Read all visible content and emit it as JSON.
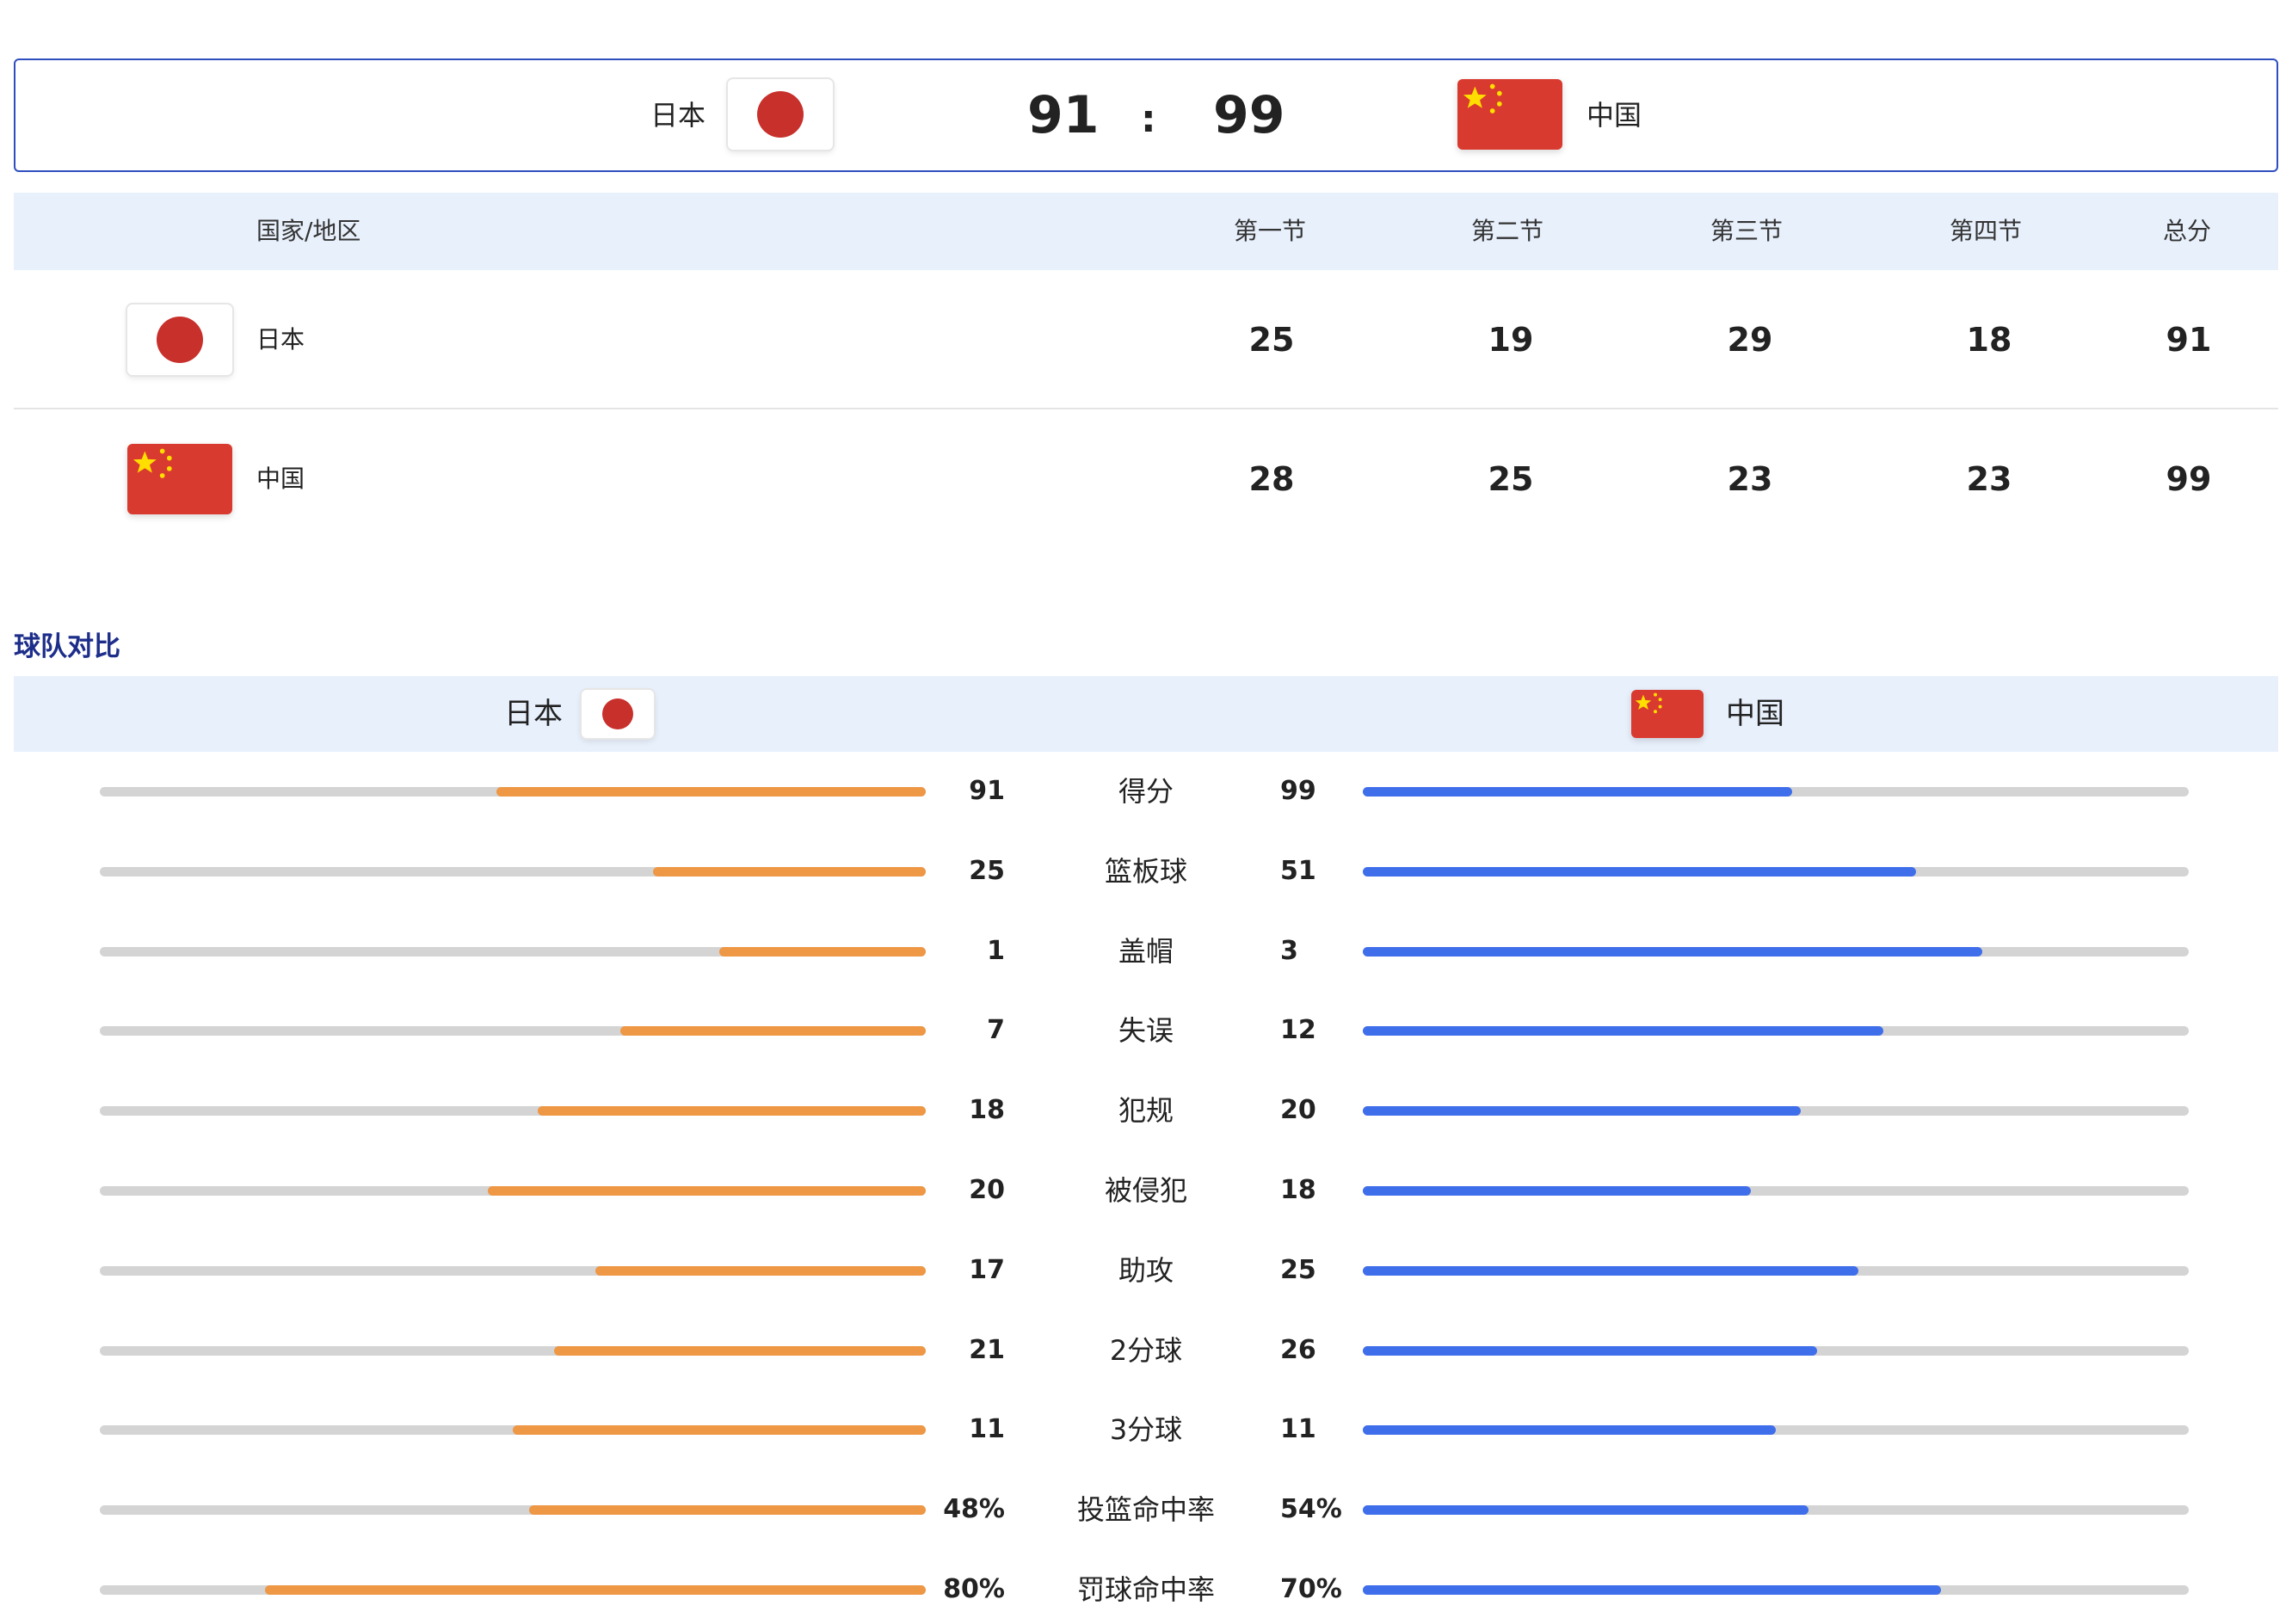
{
  "header": {
    "home_name": "日本",
    "home_score": "91",
    "separator": ":",
    "away_score": "99",
    "away_name": "中国"
  },
  "quarters": {
    "headers": [
      "国家/地区",
      "第一节",
      "第二节",
      "第三节",
      "第四节",
      "总分"
    ],
    "rows": [
      {
        "team": "日本",
        "flag": "japan-flag",
        "values": [
          "25",
          "19",
          "29",
          "18",
          "91"
        ]
      },
      {
        "team": "中国",
        "flag": "china-flag",
        "values": [
          "28",
          "25",
          "23",
          "23",
          "99"
        ]
      }
    ]
  },
  "compare": {
    "title": "球队对比",
    "home_name": "日本",
    "away_name": "中国",
    "colors": {
      "home_bar": "#ee9745",
      "away_bar": "#3f6eeb",
      "track": "#d4d4d4"
    },
    "stats": [
      {
        "label": "得分",
        "home": "91",
        "away": "99",
        "home_ratio": 0.52,
        "away_ratio": 0.52
      },
      {
        "label": "篮板球",
        "home": "25",
        "away": "51",
        "home_ratio": 0.33,
        "away_ratio": 0.67
      },
      {
        "label": "盖帽",
        "home": "1",
        "away": "3",
        "home_ratio": 0.25,
        "away_ratio": 0.75
      },
      {
        "label": "失误",
        "home": "7",
        "away": "12",
        "home_ratio": 0.37,
        "away_ratio": 0.63
      },
      {
        "label": "犯规",
        "home": "18",
        "away": "20",
        "home_ratio": 0.47,
        "away_ratio": 0.53
      },
      {
        "label": "被侵犯",
        "home": "20",
        "away": "18",
        "home_ratio": 0.53,
        "away_ratio": 0.47
      },
      {
        "label": "助攻",
        "home": "17",
        "away": "25",
        "home_ratio": 0.4,
        "away_ratio": 0.6
      },
      {
        "label": "2分球",
        "home": "21",
        "away": "26",
        "home_ratio": 0.45,
        "away_ratio": 0.55
      },
      {
        "label": "3分球",
        "home": "11",
        "away": "11",
        "home_ratio": 0.5,
        "away_ratio": 0.5
      },
      {
        "label": "投篮命中率",
        "home": "48%",
        "away": "54%",
        "home_ratio": 0.48,
        "away_ratio": 0.54
      },
      {
        "label": "罚球命中率",
        "home": "80%",
        "away": "70%",
        "home_ratio": 0.8,
        "away_ratio": 0.7
      }
    ]
  }
}
